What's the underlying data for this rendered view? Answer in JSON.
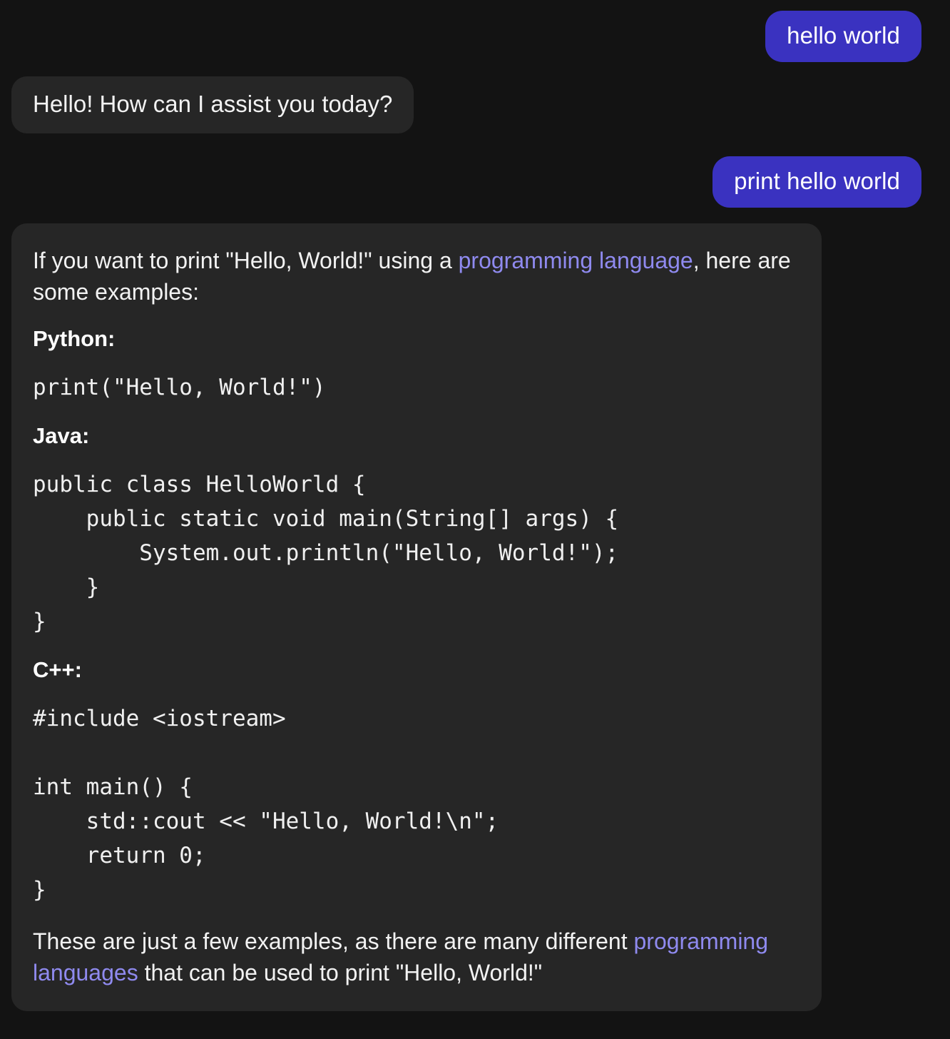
{
  "theme": {
    "page_background": "#131313",
    "assistant_bubble_background": "#262626",
    "user_bubble_background": "#3a32c0",
    "text_color": "#f2f2f2",
    "link_color": "#8f8aef"
  },
  "conversation": {
    "messages": [
      {
        "role": "user",
        "text": "hello world"
      },
      {
        "role": "assistant",
        "text": "Hello! How can I assist you today?"
      },
      {
        "role": "user",
        "text": "print hello world"
      }
    ]
  },
  "answer": {
    "intro": {
      "before_link": "If you want to print \"Hello, World!\" using a ",
      "link_text": "programming language",
      "after_link": ", here are some examples:"
    },
    "sections": [
      {
        "heading": "Python:",
        "code": "print(\"Hello, World!\")"
      },
      {
        "heading": "Java:",
        "code": "public class HelloWorld {\n    public static void main(String[] args) {\n        System.out.println(\"Hello, World!\");\n    }\n}"
      },
      {
        "heading": "C++:",
        "code": "#include <iostream>\n\nint main() {\n    std::cout << \"Hello, World!\\n\";\n    return 0;\n}"
      }
    ],
    "outro": {
      "before_link": "These are just a few examples, as there are many different ",
      "link_text": "programming languages",
      "after_link": " that can be used to print \"Hello, World!\""
    }
  }
}
